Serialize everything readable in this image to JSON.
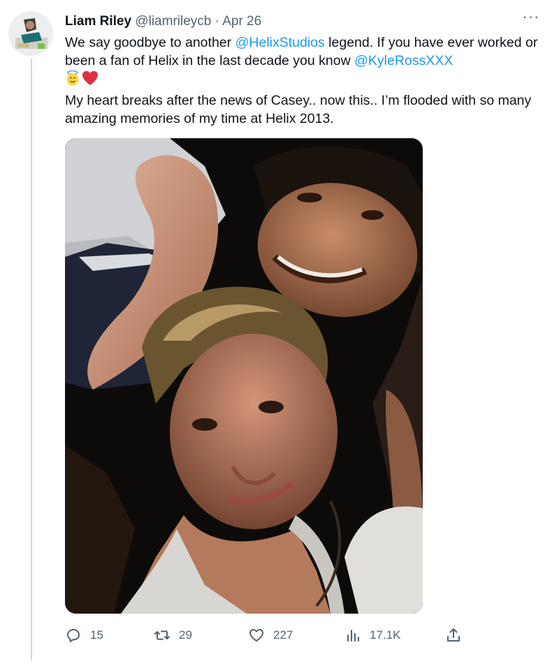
{
  "tweet": {
    "author": {
      "name": "Liam Riley",
      "handle": "@liamrileycb",
      "separator": "·",
      "date": "Apr 26"
    },
    "more_icon": "more-horizontal-icon",
    "text": {
      "line1_prefix": "We say goodbye to another ",
      "mention1": "@HelixStudios",
      "line1_suffix": " legend. If you have ever worked or been a fan of Helix in the last decade you know ",
      "mention2": "@KyleRossXXX",
      "emojis": [
        "angel-emoji",
        "red-heart-emoji"
      ],
      "paragraph2": "My heart breaks after the news of Casey.. now this.. I’m flooded with so many amazing memories of my time at Helix 2013."
    },
    "media": {
      "type": "photo"
    },
    "actions": {
      "reply": {
        "icon": "reply-icon",
        "count": "15"
      },
      "retweet": {
        "icon": "retweet-icon",
        "count": "29"
      },
      "like": {
        "icon": "heart-icon",
        "count": "227"
      },
      "views": {
        "icon": "views-icon",
        "count": "17.1K"
      },
      "share": {
        "icon": "share-icon"
      }
    },
    "colors": {
      "link": "#1d9bf0",
      "secondary_text": "#536471",
      "thread_line": "#cfd9de"
    }
  }
}
